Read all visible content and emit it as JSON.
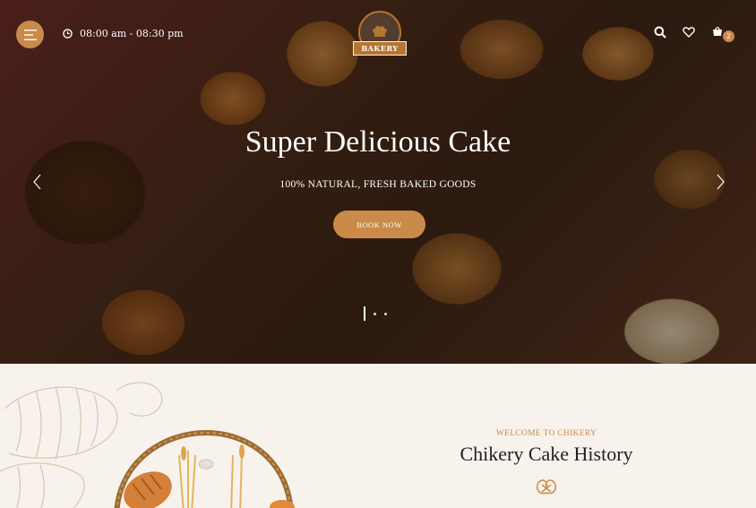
{
  "header": {
    "hours": "08:00 am - 08:30 pm",
    "logo_text": "BAKERY",
    "cart_count": "2"
  },
  "hero": {
    "title": "Super Delicious Cake",
    "subtitle": "100% NATURAL, FRESH BAKED GOODS",
    "button_label": "BOOK NOW",
    "slide_count": 3,
    "active_slide": 1
  },
  "about": {
    "eyebrow": "WELCOME TO CHIKERY",
    "title": "Chikery Cake History"
  },
  "icons": {
    "menu": "hamburger-icon",
    "clock": "clock-icon",
    "search": "search-icon",
    "wishlist": "heart-icon",
    "cart": "cart-icon",
    "prev": "chevron-left-icon",
    "next": "chevron-right-icon",
    "divider": "pretzel-icon"
  },
  "colors": {
    "accent": "#c98a4a",
    "background": "#f7f2ec",
    "title_dark": "#222222"
  }
}
